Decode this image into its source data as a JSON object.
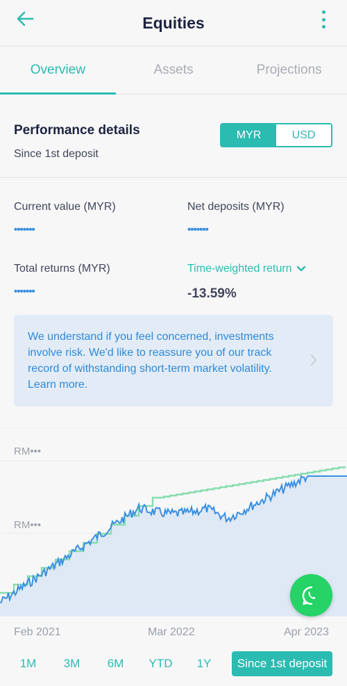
{
  "header": {
    "title": "Equities",
    "back_icon": "arrow-left-icon",
    "menu_icon": "more-vertical-icon"
  },
  "tabs": [
    {
      "label": "Overview",
      "active": true
    },
    {
      "label": "Assets",
      "active": false
    },
    {
      "label": "Projections",
      "active": false
    }
  ],
  "performance": {
    "title": "Performance details",
    "subtitle": "Since 1st deposit",
    "currency": {
      "options": [
        "MYR",
        "USD"
      ],
      "selected": "MYR"
    }
  },
  "stats": {
    "current_value": {
      "label": "Current value (MYR)",
      "value": "•••••••"
    },
    "net_deposits": {
      "label": "Net deposits (MYR)",
      "value": "•••••••"
    },
    "total_returns": {
      "label": "Total returns (MYR)",
      "value": "•••••••"
    },
    "return_metric": {
      "label": "Time-weighted return",
      "value": "-13.59%"
    }
  },
  "notice": {
    "text": "We understand if you feel concerned, investments involve risk. We'd like to reassure you of our track record of withstanding short-term market volatility. Learn more."
  },
  "chart": {
    "y_labels": [
      "RM•••",
      "RM•••"
    ],
    "x_labels": [
      "Feb 2021",
      "Mar 2022",
      "Apr 2023"
    ],
    "colors": {
      "value_line": "#3a8fe0",
      "value_fill": "#dfe9f6",
      "deposit_line": "#86dcae"
    }
  },
  "chart_data": {
    "type": "line",
    "x": [
      "Feb 2021",
      "Mar 2022",
      "Apr 2023"
    ],
    "series": [],
    "grid": true,
    "legend": "none"
  },
  "ranges": [
    {
      "label": "1M",
      "active": false
    },
    {
      "label": "3M",
      "active": false
    },
    {
      "label": "6M",
      "active": false
    },
    {
      "label": "YTD",
      "active": false
    },
    {
      "label": "1Y",
      "active": false
    },
    {
      "label": "Since 1st deposit",
      "active": true
    }
  ],
  "fab": {
    "icon": "whatsapp-icon"
  }
}
